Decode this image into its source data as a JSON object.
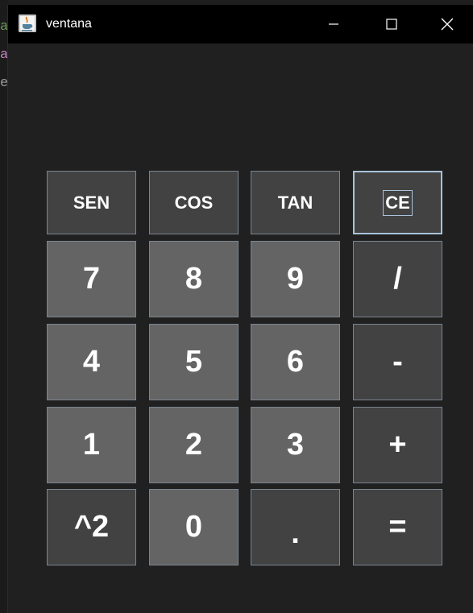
{
  "background_editor": {
    "fragments": [
      {
        "text": "ar",
        "color": "#6a9955"
      },
      {
        "text": "a",
        "color": "#c586c0"
      },
      {
        "text": "e",
        "color": "#9a9a9a"
      }
    ]
  },
  "window": {
    "title": "ventana",
    "icon": "java-cup-icon",
    "controls": [
      "minimize-icon",
      "maximize-icon",
      "close-icon"
    ]
  },
  "calculator": {
    "function_row": [
      {
        "label": "SEN",
        "name": "sen-button"
      },
      {
        "label": "COS",
        "name": "cos-button"
      },
      {
        "label": "TAN",
        "name": "tan-button"
      },
      {
        "label": "CE",
        "name": "ce-button"
      }
    ],
    "rows": [
      [
        {
          "label": "7",
          "name": "digit-7-button"
        },
        {
          "label": "8",
          "name": "digit-8-button"
        },
        {
          "label": "9",
          "name": "digit-9-button"
        },
        {
          "label": "/",
          "name": "divide-button"
        }
      ],
      [
        {
          "label": "4",
          "name": "digit-4-button"
        },
        {
          "label": "5",
          "name": "digit-5-button"
        },
        {
          "label": "6",
          "name": "digit-6-button"
        },
        {
          "label": "-",
          "name": "subtract-button"
        }
      ],
      [
        {
          "label": "1",
          "name": "digit-1-button"
        },
        {
          "label": "2",
          "name": "digit-2-button"
        },
        {
          "label": "3",
          "name": "digit-3-button"
        },
        {
          "label": "+",
          "name": "add-button"
        }
      ],
      [
        {
          "label": "^2",
          "name": "square-button"
        },
        {
          "label": "0",
          "name": "digit-0-button"
        },
        {
          "label": ".",
          "name": "decimal-point-button"
        },
        {
          "label": "=",
          "name": "equals-button"
        }
      ]
    ],
    "colors": {
      "light_key": "#646464",
      "dark_key": "#424242",
      "key_border": "#7a8590",
      "focus_border": "#a8c2da",
      "panel": "#202020",
      "titlebar": "#000000"
    }
  }
}
